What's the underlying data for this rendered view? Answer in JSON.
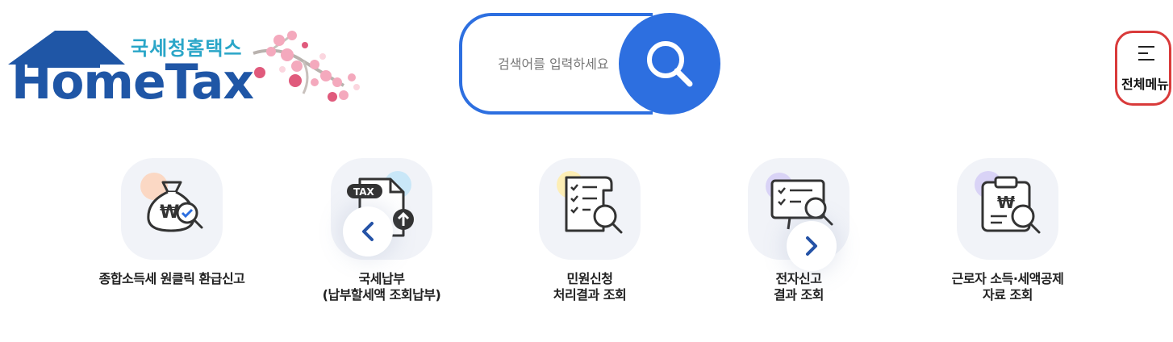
{
  "header": {
    "logo_korean": "국세청홈택스",
    "logo_english": "HomeTax"
  },
  "search": {
    "placeholder": "검색어를 입력하세요",
    "icon": "search-icon",
    "accent_color": "#2d6fe0"
  },
  "menu": {
    "label": "전체메뉴",
    "icon": "hamburger-icon",
    "highlight_color": "#d93a3a"
  },
  "carousel": {
    "prev_icon": "chevron-left-icon",
    "next_icon": "chevron-right-icon"
  },
  "services": [
    {
      "line1": "종합소득세 원클릭 환급신고",
      "line2": "",
      "icon": "money-bag-search-icon",
      "dot_color": "#fbd8c4"
    },
    {
      "line1": "국세납부",
      "line2": "(납부할세액 조회납부)",
      "icon": "tax-document-upload-icon",
      "dot_color": "#c9e7f8"
    },
    {
      "line1": "민원신청",
      "line2": "처리결과 조회",
      "icon": "checklist-search-icon",
      "dot_color": "#fdeeb5"
    },
    {
      "line1": "전자신고",
      "line2": "결과 조회",
      "icon": "monitor-checklist-search-icon",
      "dot_color": "#d9d3f6"
    },
    {
      "line1": "근로자 소득·세액공제",
      "line2": "자료 조회",
      "icon": "clipboard-won-search-icon",
      "dot_color": "#d9d3f6"
    }
  ]
}
